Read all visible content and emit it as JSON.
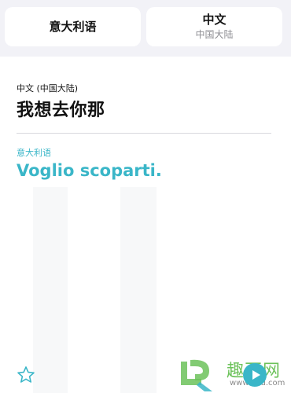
{
  "languages": {
    "source_button": {
      "label": "意大利语"
    },
    "target_button": {
      "label": "中文",
      "sublabel": "中国大陆"
    }
  },
  "source": {
    "language_label": "中文 (中国大陆)",
    "text": "我想去你那"
  },
  "translation": {
    "language_label": "意大利语",
    "text": "Voglio scoparti."
  },
  "icons": {
    "favorite": "star-icon",
    "play": "play-icon"
  },
  "watermark": {
    "text": "趣百网",
    "url": "www.q2d.com"
  },
  "colors": {
    "accent": "#3ab6c8",
    "background_bar": "#f2f2f7",
    "watermark_green": "#6cc25a"
  }
}
